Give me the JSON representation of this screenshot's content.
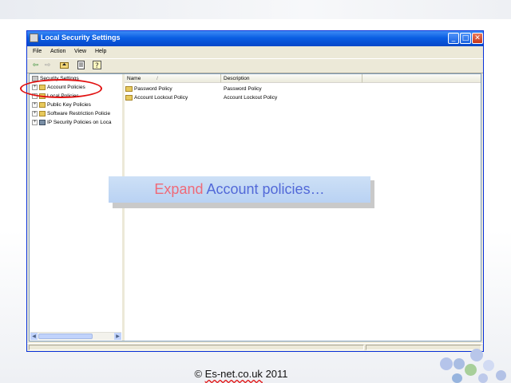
{
  "window": {
    "title": "Local Security Settings",
    "controls": {
      "minimize": "_",
      "maximize": "□",
      "close": "✕"
    }
  },
  "menu": [
    "File",
    "Action",
    "View",
    "Help"
  ],
  "toolbar": [
    "back-icon",
    "forward-icon",
    "up-icon",
    "properties-icon",
    "help-icon"
  ],
  "tree": {
    "root": "Security Settings",
    "items": [
      {
        "label": "Account Policies",
        "icon": "folder-icon"
      },
      {
        "label": "Local Policies",
        "icon": "folder-icon"
      },
      {
        "label": "Public Key Policies",
        "icon": "folder-icon"
      },
      {
        "label": "Software Restriction Policie",
        "icon": "folder-icon"
      },
      {
        "label": "IP Security Policies on Loca",
        "icon": "network-security-icon"
      }
    ]
  },
  "list": {
    "columns": [
      "Name",
      "Description"
    ],
    "sort_indicator": "/",
    "rows": [
      {
        "name": "Password Policy",
        "description": "Password Policy"
      },
      {
        "name": "Account Lockout Policy",
        "description": "Account Lockout Policy"
      }
    ]
  },
  "caption": {
    "part1": "Expand",
    "part2": "Account policies…"
  },
  "footer": {
    "prefix": "© ",
    "site": "Es-net.co.uk",
    "year": "2011"
  },
  "colors": {
    "highlight_ring": "#e11010",
    "caption_accent": "#ef6a78",
    "caption_text": "#5269d8",
    "titlebar": "#0a5ee3"
  }
}
